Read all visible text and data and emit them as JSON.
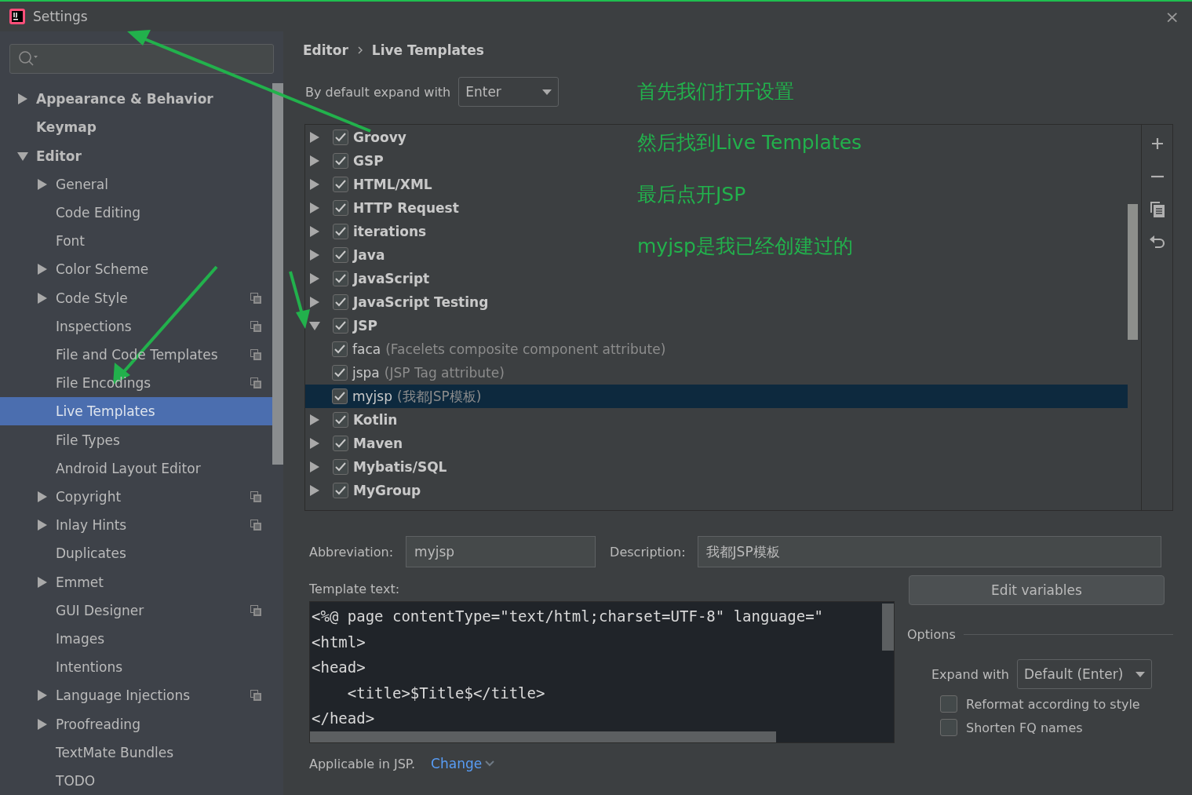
{
  "window": {
    "title": "Settings",
    "close": "×"
  },
  "sidebar": {
    "items": [
      {
        "label": "Appearance & Behavior",
        "expanded": false,
        "selected": false
      },
      {
        "label": "Keymap",
        "selected": false
      },
      {
        "label": "Editor",
        "expanded": true,
        "selected": false,
        "children": [
          {
            "label": "General",
            "expanded": false,
            "selected": false,
            "project_level": false
          },
          {
            "label": "Code Editing",
            "selected": false,
            "project_level": false
          },
          {
            "label": "Font",
            "selected": false,
            "project_level": false
          },
          {
            "label": "Color Scheme",
            "expanded": false,
            "selected": false,
            "project_level": false
          },
          {
            "label": "Code Style",
            "expanded": false,
            "selected": false,
            "project_level": true
          },
          {
            "label": "Inspections",
            "selected": false,
            "project_level": true
          },
          {
            "label": "File and Code Templates",
            "selected": false,
            "project_level": true
          },
          {
            "label": "File Encodings",
            "selected": false,
            "project_level": true
          },
          {
            "label": "Live Templates",
            "selected": true,
            "project_level": false
          },
          {
            "label": "File Types",
            "selected": false,
            "project_level": false
          },
          {
            "label": "Android Layout Editor",
            "selected": false,
            "project_level": false
          },
          {
            "label": "Copyright",
            "expanded": false,
            "selected": false,
            "project_level": true
          },
          {
            "label": "Inlay Hints",
            "expanded": false,
            "selected": false,
            "project_level": true
          },
          {
            "label": "Duplicates",
            "selected": false,
            "project_level": false
          },
          {
            "label": "Emmet",
            "expanded": false,
            "selected": false,
            "project_level": false
          },
          {
            "label": "GUI Designer",
            "selected": false,
            "project_level": true
          },
          {
            "label": "Images",
            "selected": false,
            "project_level": false
          },
          {
            "label": "Intentions",
            "selected": false,
            "project_level": false
          },
          {
            "label": "Language Injections",
            "expanded": false,
            "selected": false,
            "project_level": true
          },
          {
            "label": "Proofreading",
            "expanded": false,
            "selected": false,
            "project_level": false
          },
          {
            "label": "TextMate Bundles",
            "selected": false,
            "project_level": false
          },
          {
            "label": "TODO",
            "selected": false,
            "project_level": false
          }
        ]
      }
    ]
  },
  "breadcrumb": [
    "Editor",
    "Live Templates"
  ],
  "expand_default": {
    "label": "By default expand with",
    "value": "Enter"
  },
  "templates": [
    {
      "label": "Groovy",
      "checked": true,
      "expanded": false,
      "selected": false
    },
    {
      "label": "GSP",
      "checked": true,
      "expanded": false,
      "selected": false
    },
    {
      "label": "HTML/XML",
      "checked": true,
      "expanded": false,
      "selected": false
    },
    {
      "label": "HTTP Request",
      "checked": true,
      "expanded": false,
      "selected": false
    },
    {
      "label": "iterations",
      "checked": true,
      "expanded": false,
      "selected": false
    },
    {
      "label": "Java",
      "checked": true,
      "expanded": false,
      "selected": false
    },
    {
      "label": "JavaScript",
      "checked": true,
      "expanded": false,
      "selected": false
    },
    {
      "label": "JavaScript Testing",
      "checked": true,
      "expanded": false,
      "selected": false
    },
    {
      "label": "JSP",
      "checked": true,
      "expanded": true,
      "selected": false,
      "children": [
        {
          "label": "faca",
          "description": "(Facelets composite component attribute)",
          "checked": true,
          "selected": false
        },
        {
          "label": "jspa",
          "description": "(JSP Tag attribute)",
          "checked": true,
          "selected": false
        },
        {
          "label": "myjsp",
          "description": "(我都JSP模板)",
          "checked": true,
          "selected": true
        }
      ]
    },
    {
      "label": "Kotlin",
      "checked": true,
      "expanded": false,
      "selected": false
    },
    {
      "label": "Maven",
      "checked": true,
      "expanded": false,
      "selected": false
    },
    {
      "label": "Mybatis/SQL",
      "checked": true,
      "expanded": false,
      "selected": false
    },
    {
      "label": "MyGroup",
      "checked": true,
      "expanded": false,
      "selected": false
    }
  ],
  "annotations": [
    "首先我们打开设置",
    "然后找到Live Templates",
    "最后点开JSP",
    "myjsp是我已经创建过的"
  ],
  "abbreviation": {
    "label": "Abbreviation:",
    "value": "myjsp"
  },
  "description": {
    "label": "Description:",
    "value": "我都JSP模板"
  },
  "template_text": {
    "label": "Template text:",
    "lines": [
      "<%@ page contentType=\"text/html;charset=UTF-8\" language=\"",
      "<html>",
      "<head>",
      "    <title>$Title$</title>",
      "</head>"
    ]
  },
  "edit_variables": "Edit variables",
  "options": {
    "title": "Options",
    "expand_label": "Expand with",
    "expand_value": "Default (Enter)",
    "checkboxes": [
      {
        "label": "Reformat according to style",
        "checked": false
      },
      {
        "label": "Shorten FQ names",
        "checked": false
      }
    ]
  },
  "applicable": {
    "text": "Applicable in JSP.",
    "link": "Change"
  }
}
